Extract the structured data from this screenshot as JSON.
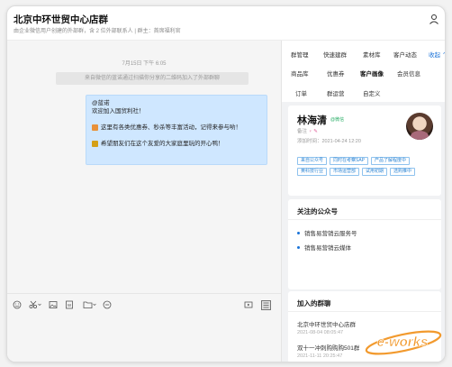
{
  "header": {
    "title": "北京中环世贸中心店群",
    "subtitle": "由企业微信用户创建的外部群，含 2 位外部联系人 | 群主：首席福利官"
  },
  "chat": {
    "timestamp": "7月15日 下午 6:05",
    "system_message": "来自微信的蓝诺通过扫描你分享的二维码加入了外部群聊",
    "bubble": {
      "line1": "@蓝诺",
      "line2": "欢迎加入国贸利社！",
      "line3": "这里有各类优惠券、秒杀等丰富活动，记得来参与哟！",
      "line4": "希望朋友们在这个友爱的大家庭里玩的开心鸭！"
    }
  },
  "right_panel": {
    "tabs": {
      "row1": [
        "群管理",
        "快速建群",
        "素材库",
        "客户动态"
      ],
      "more": "收起 ⌃",
      "row2": [
        "商品库",
        "优惠券",
        "客户画像",
        "会员信息"
      ],
      "row3": [
        "订单",
        "群运营",
        "自定义"
      ]
    },
    "active_tab": "客户画像",
    "customer": {
      "name": "林海清",
      "wechat_tag": "@微信",
      "mark_label": "备注",
      "gender": "♀ ✎",
      "added_time": "添加时间：2021-04-24 12:20",
      "tags": [
        "来自公众号",
        "同时在考察SAP",
        "产品了解程度中",
        "黄科技行业",
        "市场运营部",
        "试用初期",
        "选购推中"
      ]
    },
    "accounts": {
      "title": "关注的公众号",
      "items": [
        "销售易营销云服务号",
        "销售易营销云媒体"
      ]
    },
    "groups": {
      "title": "加入的群聊",
      "items": [
        {
          "name": "北京中环世贸中心店群",
          "time": "2021-08-04 08:05:47"
        },
        {
          "name": "双十一冲刺购购购501群",
          "time": "2021-11-11 20:25:47"
        }
      ]
    }
  },
  "watermark": {
    "text": "e-works"
  },
  "colors": {
    "accent": "#1a73d9",
    "bubble": "#cfe7ff",
    "tag": "#2f86d4"
  }
}
